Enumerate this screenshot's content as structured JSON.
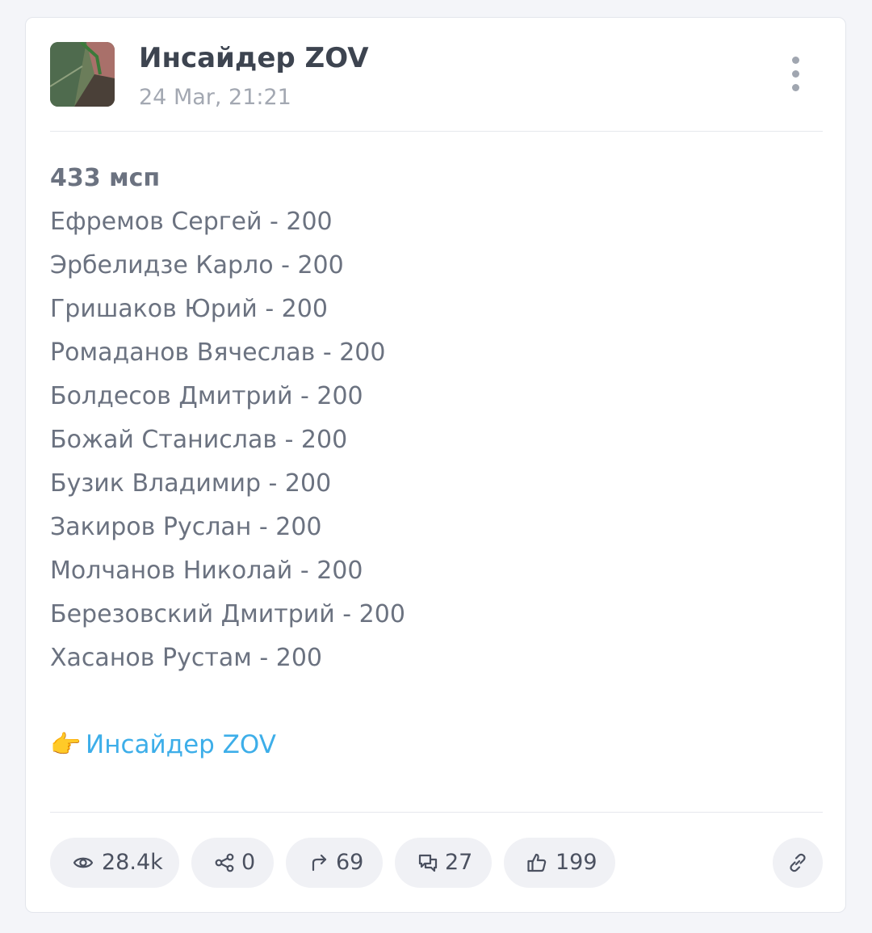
{
  "post": {
    "channel_name": "Инсайдер ZOV",
    "date": "24 Mar, 21:21",
    "heading": "433 мсп",
    "lines": [
      "Ефремов Сергей - 200",
      "Эрбелидзе Карло - 200",
      "Гришаков Юрий - 200",
      "Ромаданов Вячеслав - 200",
      "Болдесов Дмитрий - 200",
      "Божай Станислав - 200",
      "Бузик Владимир - 200",
      "Закиров Руслан - 200",
      "Молчанов Николай - 200",
      "Березовский Дмитрий - 200",
      "Хасанов Рустам - 200"
    ],
    "signature_emoji": "👉",
    "signature_link": "Инсайдер ZOV"
  },
  "stats": {
    "views": "28.4k",
    "shares": "0",
    "forwards": "69",
    "comments": "27",
    "likes": "199"
  },
  "icons": {
    "views": "eye-icon",
    "shares": "share-icon",
    "forwards": "forward-arrow-icon",
    "comments": "comments-icon",
    "likes": "thumbs-up-icon",
    "link": "link-icon",
    "more": "more-vertical-icon"
  },
  "colors": {
    "link": "#3daee9",
    "pill_bg": "#f0f1f5",
    "text": "#6b7280",
    "title": "#3d4450"
  }
}
